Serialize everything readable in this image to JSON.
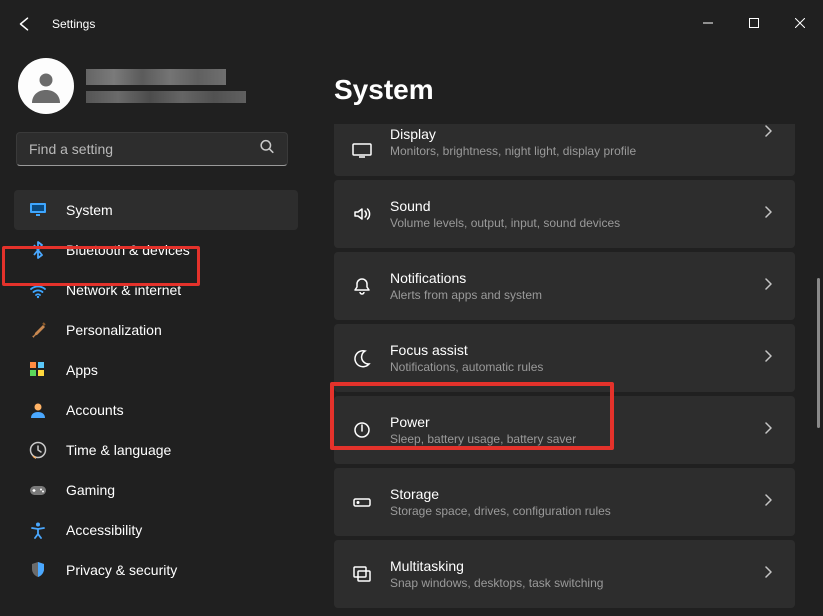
{
  "window": {
    "title": "Settings"
  },
  "search": {
    "placeholder": "Find a setting"
  },
  "sidebar": {
    "items": [
      {
        "label": "System",
        "icon": "monitor",
        "active": true
      },
      {
        "label": "Bluetooth & devices",
        "icon": "bluetooth",
        "active": false
      },
      {
        "label": "Network & internet",
        "icon": "wifi",
        "active": false
      },
      {
        "label": "Personalization",
        "icon": "brush",
        "active": false
      },
      {
        "label": "Apps",
        "icon": "grid",
        "active": false
      },
      {
        "label": "Accounts",
        "icon": "person",
        "active": false
      },
      {
        "label": "Time & language",
        "icon": "clock",
        "active": false
      },
      {
        "label": "Gaming",
        "icon": "gamepad",
        "active": false
      },
      {
        "label": "Accessibility",
        "icon": "accessibility",
        "active": false
      },
      {
        "label": "Privacy & security",
        "icon": "shield",
        "active": false
      }
    ]
  },
  "main": {
    "heading": "System",
    "cards": [
      {
        "title": "Display",
        "sub": "Monitors, brightness, night light, display profile",
        "icon": "display"
      },
      {
        "title": "Sound",
        "sub": "Volume levels, output, input, sound devices",
        "icon": "sound"
      },
      {
        "title": "Notifications",
        "sub": "Alerts from apps and system",
        "icon": "bell"
      },
      {
        "title": "Focus assist",
        "sub": "Notifications, automatic rules",
        "icon": "moon"
      },
      {
        "title": "Power",
        "sub": "Sleep, battery usage, battery saver",
        "icon": "power"
      },
      {
        "title": "Storage",
        "sub": "Storage space, drives, configuration rules",
        "icon": "drive"
      },
      {
        "title": "Multitasking",
        "sub": "Snap windows, desktops, task switching",
        "icon": "multitask"
      }
    ]
  },
  "highlights": {
    "system_nav": true,
    "power_card": true
  },
  "colors": {
    "highlight": "#e4322b",
    "bg": "#202020",
    "card": "#2d2d2d"
  }
}
